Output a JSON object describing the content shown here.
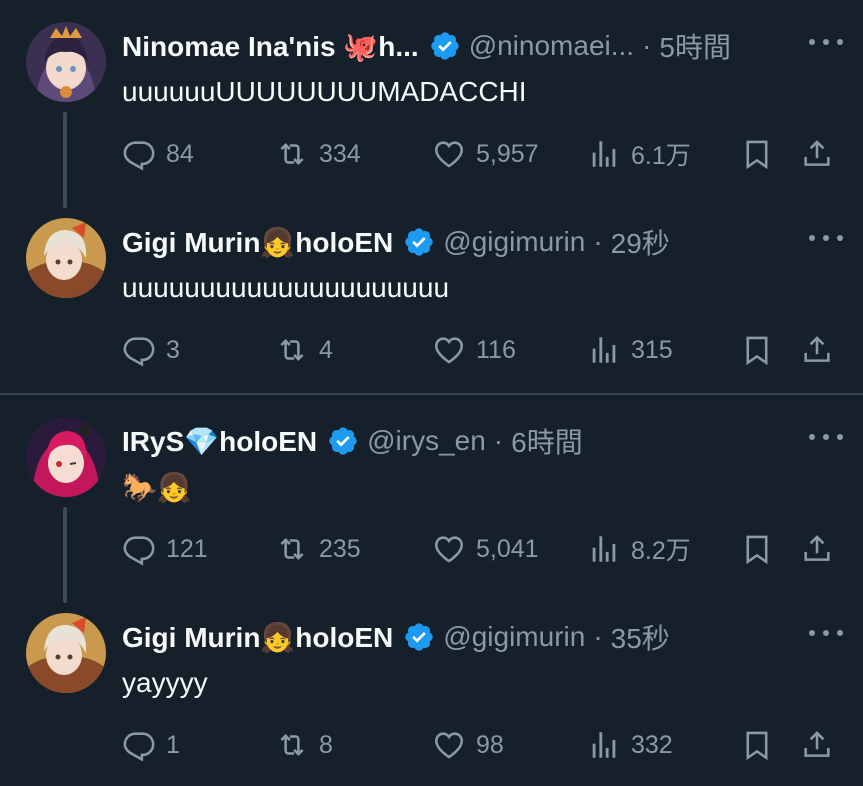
{
  "colors": {
    "background": "#15202b",
    "text": "#f7f9f9",
    "muted": "#8b98a5",
    "verified": "#1d9bf0",
    "divider": "#38444d"
  },
  "tweets": [
    {
      "name": "Ninomae Ina'nis 🐙h...",
      "handle": "@ninomaei...",
      "time": "5時間",
      "text": "uuuuuuUUUUUUUUMADACCHI",
      "replies": "84",
      "retweets": "334",
      "likes": "5,957",
      "views": "6.1万"
    },
    {
      "name": "Gigi Murin👧holoEN",
      "handle": "@gigimurin",
      "time": "29秒",
      "text": "uuuuuuuuuuuuuuuuuuuuu",
      "replies": "3",
      "retweets": "4",
      "likes": "116",
      "views": "315"
    },
    {
      "name": "IRyS💎holoEN",
      "handle": "@irys_en",
      "time": "6時間",
      "text": "🐎👧",
      "replies": "121",
      "retweets": "235",
      "likes": "5,041",
      "views": "8.2万"
    },
    {
      "name": "Gigi Murin👧holoEN",
      "handle": "@gigimurin",
      "time": "35秒",
      "text": "yayyyy",
      "replies": "1",
      "retweets": "8",
      "likes": "98",
      "views": "332"
    }
  ],
  "separator": "·"
}
